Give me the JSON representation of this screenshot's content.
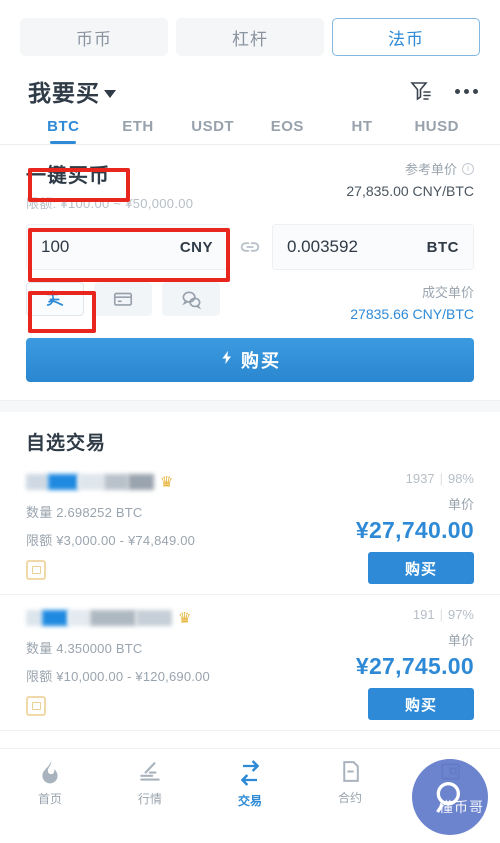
{
  "segmented": {
    "items": [
      {
        "label": "币币",
        "active": false
      },
      {
        "label": "杠杆",
        "active": false
      },
      {
        "label": "法币",
        "active": true
      }
    ]
  },
  "header": {
    "title": "我要买",
    "caret_icon": "caret-down-icon",
    "filter_icon": "filter-icon",
    "more_icon": "more-horizontal-icon"
  },
  "coin_tabs": [
    {
      "label": "BTC",
      "active": true
    },
    {
      "label": "ETH",
      "active": false
    },
    {
      "label": "USDT",
      "active": false
    },
    {
      "label": "EOS",
      "active": false
    },
    {
      "label": "HT",
      "active": false
    },
    {
      "label": "HUSD",
      "active": false
    }
  ],
  "quick_buy": {
    "title": "一键买币",
    "limit": "限额: ¥100.00 ~ ¥50,000.00",
    "ref_label": "参考单价",
    "ref_info_icon": "info-icon",
    "ref_value": "27,835.00 CNY/BTC",
    "fiat_amount": "100",
    "fiat_unit": "CNY",
    "link_icon": "link-icon",
    "crypto_amount": "0.003592",
    "crypto_unit": "BTC",
    "deal_label": "成交单价",
    "deal_value": "27835.66 CNY/BTC",
    "payments": [
      {
        "name": "alipay-icon",
        "glyph": "支",
        "selected": true
      },
      {
        "name": "bank-card-icon",
        "glyph": "▤",
        "selected": false
      },
      {
        "name": "wechat-pay-icon",
        "glyph": "◍",
        "selected": false
      }
    ],
    "buy_button": "购买",
    "buy_icon": "lightning-icon"
  },
  "listings": {
    "section_title": "自选交易",
    "labels": {
      "amount": "数量",
      "limit": "限额",
      "unit_price": "单价",
      "buy": "购买"
    },
    "rows": [
      {
        "merchant_masked": true,
        "crown_icon": "crown-icon",
        "orders": "1937",
        "completion": "98%",
        "amount": "数量 2.698252 BTC",
        "limit": "限额 ¥3,000.00 - ¥74,849.00",
        "unit_price_label": "单价",
        "price": "¥27,740.00",
        "buy_label": "购买",
        "badge_icon": "bank-transfer-icon"
      },
      {
        "merchant_masked": true,
        "crown_icon": "crown-icon",
        "orders": "191",
        "completion": "97%",
        "amount": "数量 4.350000 BTC",
        "limit": "限额 ¥10,000.00 - ¥120,690.00",
        "unit_price_label": "单价",
        "price": "¥27,745.00",
        "buy_label": "购买",
        "badge_icon": "bank-transfer-icon"
      }
    ]
  },
  "bottom_nav": [
    {
      "label": "首页",
      "icon": "flame-icon",
      "active": false
    },
    {
      "label": "行情",
      "icon": "market-chart-icon",
      "active": false
    },
    {
      "label": "交易",
      "icon": "exchange-arrows-icon",
      "active": true
    },
    {
      "label": "合约",
      "icon": "contract-icon",
      "active": false
    },
    {
      "label": "",
      "icon": "assets-icon",
      "active": false
    }
  ],
  "watermark": {
    "text": "懂币哥",
    "icon": "search-badge-icon",
    "color": "#5d77c9"
  },
  "colors": {
    "accent": "#2e8ad6",
    "annotation": "#e8261d",
    "text": "#2f3b47",
    "muted": "#9aa4ae"
  }
}
